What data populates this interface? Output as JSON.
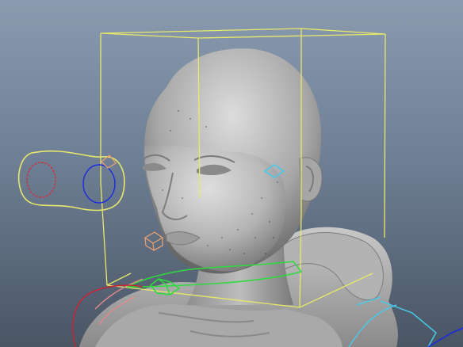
{
  "viewport": {
    "kind": "3d-viewport",
    "background": {
      "top": "#8a9bb0",
      "middle": "#6f8096",
      "bottom": "#4a5564"
    },
    "model": {
      "type": "gray-shaded-head-sculpt",
      "skin_color": "#b8b8b8",
      "garment": "hoodie"
    },
    "rig_controls": [
      {
        "name": "head-bounding-cube",
        "color": "#e8e86a"
      },
      {
        "name": "eye-aim-control",
        "color": "#e8e86a"
      },
      {
        "name": "left-eye-control",
        "color": "#d0303c"
      },
      {
        "name": "right-eye-control",
        "color": "#1a2ae0"
      },
      {
        "name": "jaw-control",
        "color": "#2ddc3c"
      },
      {
        "name": "nose-box-control",
        "color": "#e8a070"
      },
      {
        "name": "ear-diamond-control",
        "color": "#4ac8e8"
      },
      {
        "name": "neck-ring-control",
        "color": "#e0d050"
      },
      {
        "name": "shoulder-control",
        "color": "#4ac8e8"
      },
      {
        "name": "spine-control",
        "color": "#e08a8a"
      },
      {
        "name": "clavicle-control",
        "color": "#d02030"
      },
      {
        "name": "arm-control",
        "color": "#1a2ae0"
      }
    ]
  }
}
